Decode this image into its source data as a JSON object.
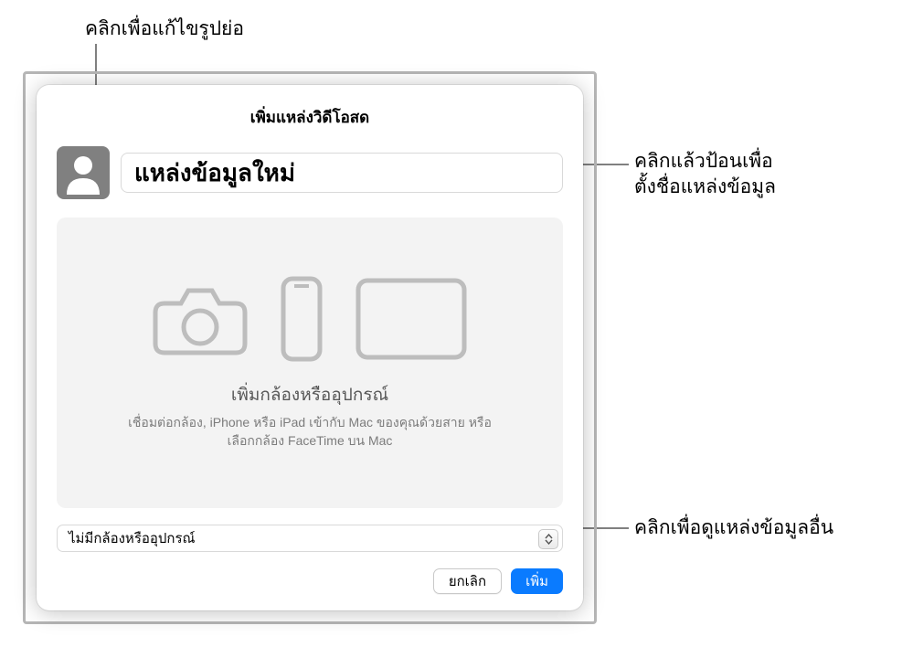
{
  "annotations": {
    "thumbnail": "คลิกเพื่อแก้ไขรูปย่อ",
    "name_line1": "คลิกแล้วป้อนเพื่อ",
    "name_line2": "ตั้งชื่อแหล่งข้อมูล",
    "sources": "คลิกเพื่อดูแหล่งข้อมูลอื่น"
  },
  "dialog": {
    "title": "เพิ่มแหล่งวิดีโอสด",
    "name_value": "แหล่งข้อมูลใหม่",
    "preview": {
      "heading": "เพิ่มกล้องหรืออุปกรณ์",
      "subtext": "เชื่อมต่อกล้อง, iPhone หรือ iPad เข้ากับ Mac ของคุณด้วยสาย หรือเลือกกล้อง FaceTime บน Mac"
    },
    "source_select": "ไม่มีกล้องหรืออุปกรณ์",
    "buttons": {
      "cancel": "ยกเลิก",
      "add": "เพิ่ม"
    }
  }
}
